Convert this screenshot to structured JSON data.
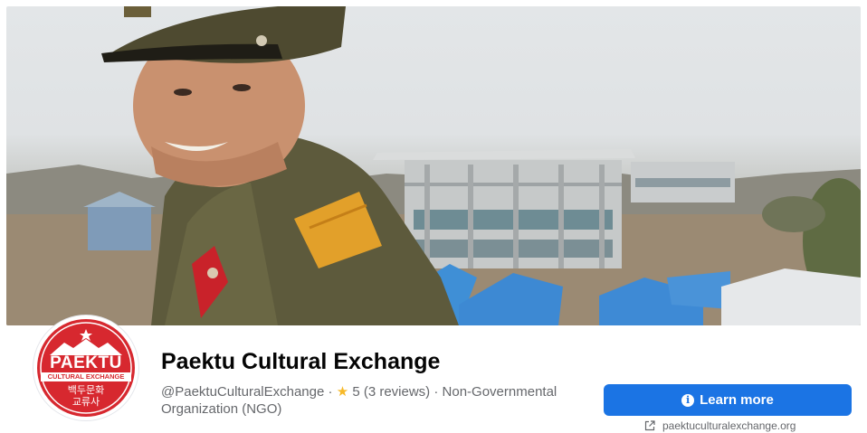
{
  "page": {
    "title": "Paektu Cultural Exchange",
    "handle": "@PaektuCulturalExchange",
    "separator": " · ",
    "rating": "5",
    "reviews": "(3 reviews)",
    "category": "Non-Governmental Organization (NGO)"
  },
  "logo": {
    "name": "PAEKTU",
    "subtitle": "CULTURAL EXCHANGE",
    "hangul_line1": "백두문화",
    "hangul_line2": "교류사"
  },
  "actions": {
    "learn_more_label": "Learn more",
    "website": "paektuculturalexchange.org"
  },
  "colors": {
    "primary_button": "#1b74e4",
    "logo_red": "#d7282f",
    "star": "#f7b928"
  },
  "icons": [
    "info-icon",
    "star-icon",
    "external-link-icon"
  ]
}
